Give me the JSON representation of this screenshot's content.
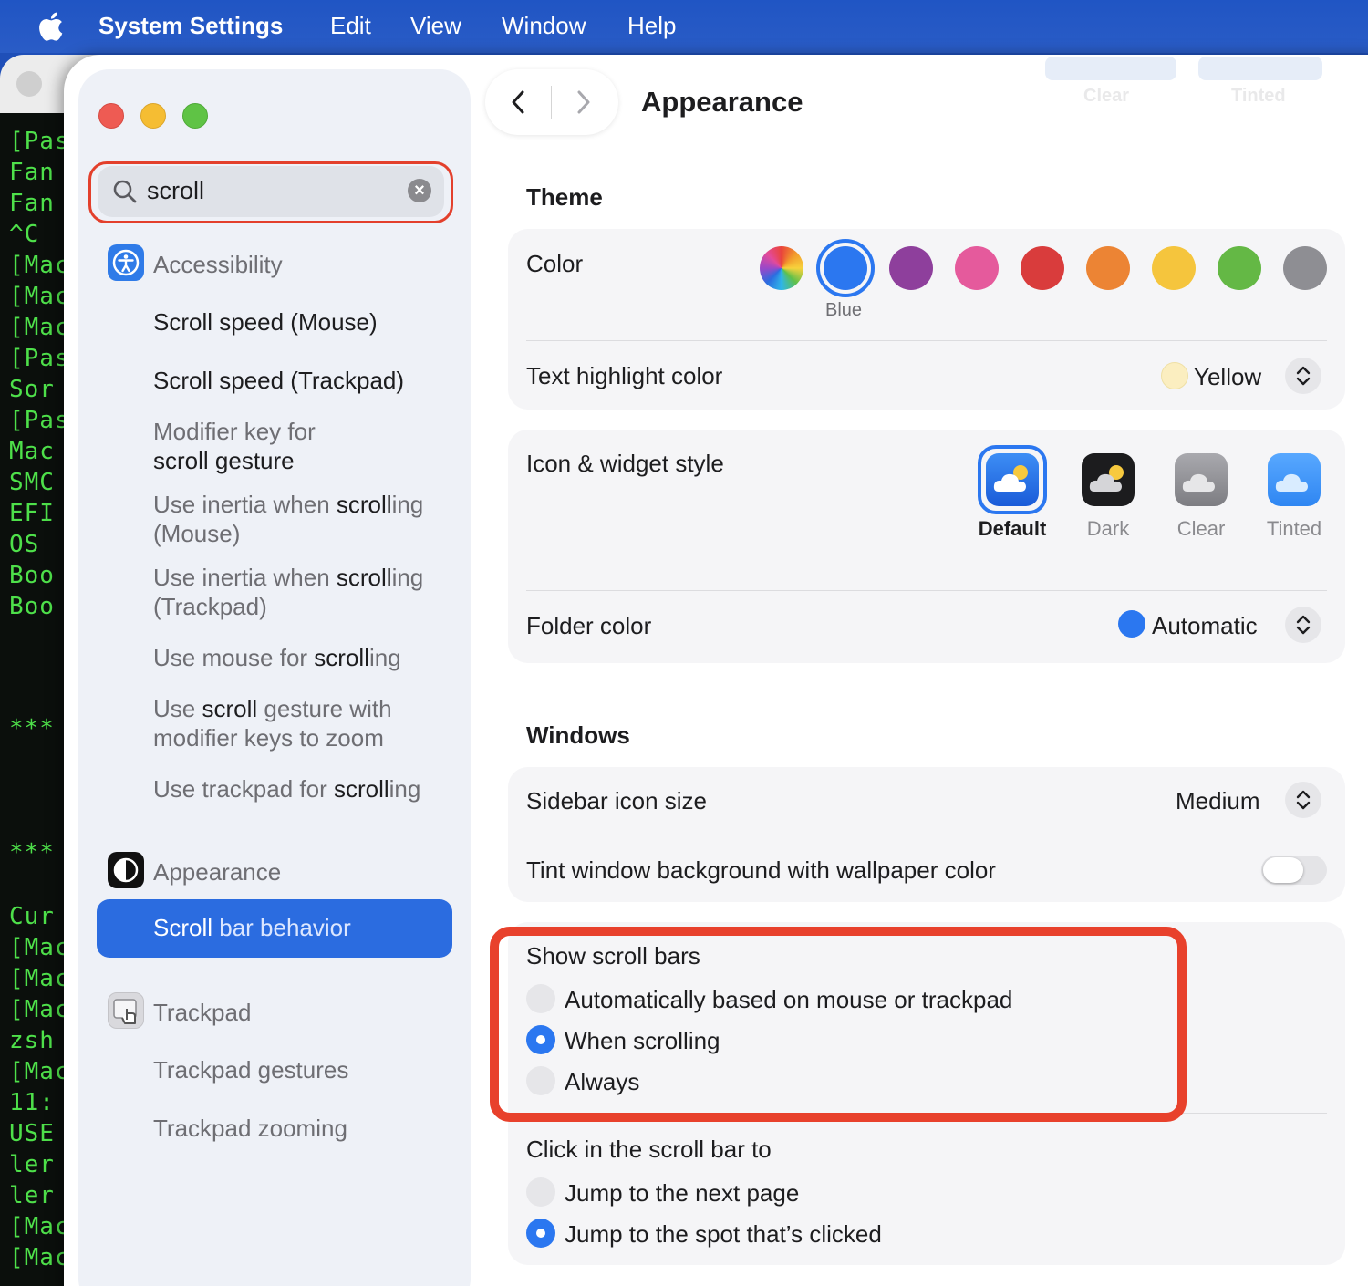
{
  "menubar": {
    "app_name": "System Settings",
    "items": [
      "Edit",
      "View",
      "Window",
      "Help"
    ]
  },
  "terminal": {
    "lines": [
      "[Pas",
      "Fan",
      "Fan",
      "^C",
      "[Mac",
      "[Mac",
      "[Mac",
      "[Pas",
      "Sor",
      "[Pas",
      "Mac",
      "SMC",
      "EFI",
      "OS",
      "Boo",
      "Boo",
      "***",
      "***",
      "Cur",
      "[Mac",
      "[Mac",
      "[Mac",
      "zsh",
      "[Mac",
      "11:",
      "USE",
      "ler",
      "ler",
      "[Mac",
      "[Mac"
    ]
  },
  "search": {
    "value": "scroll",
    "placeholder": "Search"
  },
  "sidebar": {
    "accessibility": {
      "label": "Accessibility",
      "items": [
        {
          "pre": "",
          "match": "Scroll",
          "post": " speed (Mouse)"
        },
        {
          "pre": "",
          "match": "Scroll",
          "post": " speed (Trackpad)"
        },
        {
          "pre": "Modifier key for",
          "match": "scroll",
          "post": " gesture"
        },
        {
          "pre": "Use inertia when ",
          "match": "scroll",
          "post": "ing (Mouse)"
        },
        {
          "pre": "Use inertia when ",
          "match": "scroll",
          "post": "ing (Trackpad)"
        },
        {
          "pre": "Use mouse for ",
          "match": "scroll",
          "post": "ing"
        },
        {
          "pre": "Use ",
          "match": "scroll",
          "post": " gesture with modifier keys to zoom"
        },
        {
          "pre": "Use trackpad for ",
          "match": "scroll",
          "post": "ing"
        }
      ]
    },
    "appearance": {
      "label": "Appearance",
      "selected": {
        "match": "Scroll",
        "post": " bar behavior"
      }
    },
    "trackpad": {
      "label": "Trackpad",
      "items": [
        "Trackpad gestures",
        "Trackpad zooming"
      ]
    }
  },
  "content": {
    "title": "Appearance",
    "ghost_labels": [
      "Clear",
      "Tinted"
    ],
    "theme": {
      "section": "Theme",
      "color_label": "Color",
      "selected_color_name": "Blue",
      "accent_colors": [
        "multicolor",
        "#2b77f0",
        "#8e3f9c",
        "#e55a9c",
        "#d93c3c",
        "#ec8434",
        "#f5c53d",
        "#64b845",
        "#8e8e93"
      ],
      "highlight_label": "Text highlight color",
      "highlight_value": "Yellow",
      "highlight_swatch": "#fbeec0"
    },
    "icons": {
      "label": "Icon & widget style",
      "styles": [
        "Default",
        "Dark",
        "Clear",
        "Tinted"
      ],
      "selected": "Default",
      "folder_label": "Folder color",
      "folder_value": "Automatic",
      "folder_swatch": "#2b77f0"
    },
    "windows": {
      "section": "Windows",
      "sidebar_icon_label": "Sidebar icon size",
      "sidebar_icon_value": "Medium",
      "tint_label": "Tint window background with wallpaper color",
      "tint_on": false
    },
    "scroll_bars": {
      "label": "Show scroll bars",
      "options": [
        "Automatically based on mouse or trackpad",
        "When scrolling",
        "Always"
      ],
      "selected": "When scrolling"
    },
    "click_scroll": {
      "label": "Click in the scroll bar to",
      "options": [
        "Jump to the next page",
        "Jump to the spot that’s clicked"
      ],
      "selected": "Jump to the spot that’s clicked"
    }
  },
  "colors": {
    "accent": "#2b6ce0",
    "highlight_outline": "#e8412c",
    "menubar": "#2055c4"
  }
}
